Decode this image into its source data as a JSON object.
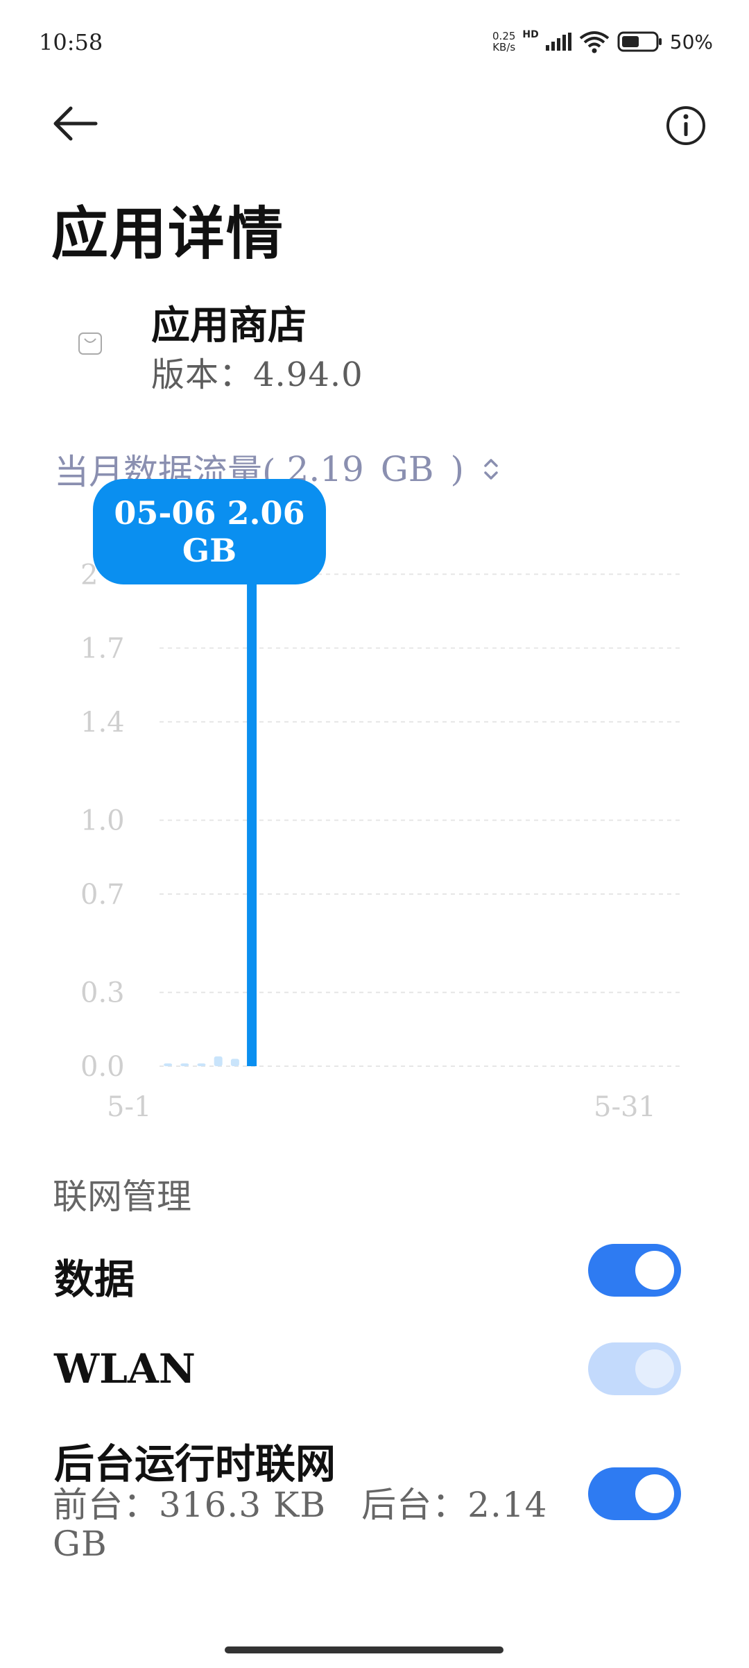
{
  "status_bar": {
    "time": "10:58",
    "net_speed_value": "0.25",
    "net_speed_unit": "KB/s",
    "network_type": "HD",
    "battery": "50%"
  },
  "header": {
    "back_icon": "arrow-left-icon",
    "info_icon": "info-circle-icon",
    "title": "应用详情"
  },
  "app": {
    "icon": "shopping-bag-icon",
    "name": "应用商店",
    "version": "版本：4.94.0"
  },
  "monthly_usage": {
    "label": "当月数据流量(",
    "value": "2.19",
    "unit": "GB",
    "close": ")",
    "sort_icon": "chevron-up-down-icon"
  },
  "tooltip": {
    "line1": "05-06 2.06",
    "line2": "GB"
  },
  "chart_data": {
    "type": "bar",
    "x_range": [
      "5-1",
      "5-31"
    ],
    "x_tick_labels": [
      "5-1",
      "5-31"
    ],
    "y_tick_labels": [
      "0.0",
      "0.3",
      "0.7",
      "1.0",
      "1.4",
      "1.7",
      "2"
    ],
    "ylim": [
      0,
      2.06
    ],
    "categories": [
      "5-1",
      "5-2",
      "5-3",
      "5-4",
      "5-5",
      "5-6"
    ],
    "values": [
      0.01,
      0.01,
      0.01,
      0.04,
      0.03,
      2.06
    ],
    "highlighted": "5-6",
    "grid": true,
    "colors": {
      "bar": "#0a8ff0",
      "bar_light": "#c9e4fb",
      "grid": "#e6e6e6",
      "tick": "#cfcfcf"
    }
  },
  "network": {
    "section_label": "联网管理",
    "data_label": "数据",
    "data_on": true,
    "wlan_label": "WLAN",
    "wlan_on": true,
    "wlan_enabled": false,
    "background_label": "后台运行时联网",
    "background_detail": "前台：316.3 KB　后台：2.14 GB",
    "background_on": true
  },
  "colors": {
    "accent": "#2e7bf2",
    "tooltip": "#0a8ff0",
    "secondary_text": "#8a8fb0"
  }
}
